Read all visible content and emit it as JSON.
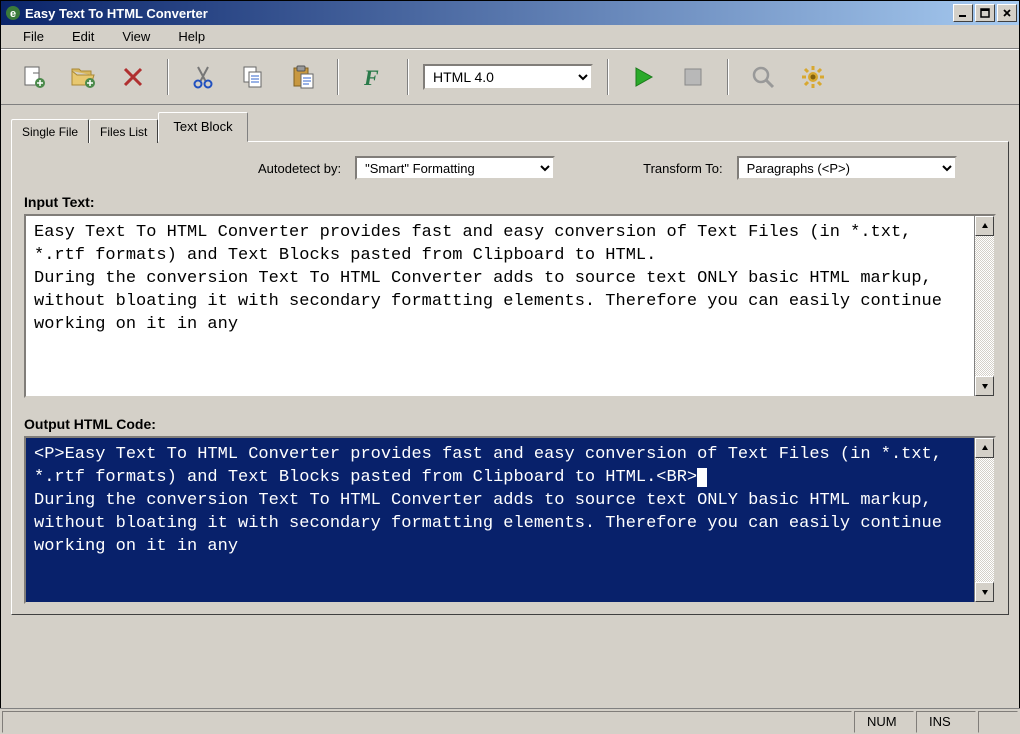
{
  "window": {
    "title": "Easy Text To HTML Converter"
  },
  "menu": {
    "file": "File",
    "edit": "Edit",
    "view": "View",
    "help": "Help"
  },
  "toolbar": {
    "format_dropdown": "HTML 4.0"
  },
  "tabs": {
    "single_file": "Single File",
    "files_list": "Files List",
    "text_block": "Text Block"
  },
  "options": {
    "autodetect_label": "Autodetect by:",
    "autodetect_value": "\"Smart\" Formatting",
    "transform_label": "Transform To:",
    "transform_value": "Paragraphs (<P>)"
  },
  "sections": {
    "input_label": "Input Text:",
    "output_label": "Output HTML Code:"
  },
  "input_text": "Easy Text To HTML Converter provides fast and easy conversion of Text Files (in *.txt, *.rtf formats) and Text Blocks pasted from Clipboard to HTML.\nDuring the conversion Text To HTML Converter adds to source text ONLY basic HTML markup, without bloating it with secondary formatting elements. Therefore you can easily continue working on it in any",
  "output_text_selected": "<P>Easy Text To HTML Converter provides fast and easy conversion of Text Files (in *.txt, *.rtf formats) and Text Blocks pasted from Clipboard to HTML.<BR>",
  "output_text_rest": "\nDuring the conversion Text To HTML Converter adds to source text ONLY basic HTML markup, without bloating it with secondary formatting elements. Therefore you can easily continue working on it in any",
  "status": {
    "num": "NUM",
    "ins": "INS"
  }
}
